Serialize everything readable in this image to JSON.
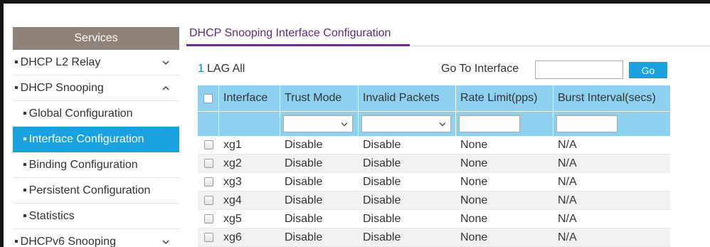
{
  "sidebar": {
    "header": "Services",
    "items": [
      {
        "label": "DHCP L2 Relay",
        "chevron": "down"
      },
      {
        "label": "DHCP Snooping",
        "chevron": "up"
      },
      {
        "label": "Global Configuration"
      },
      {
        "label": "Interface Configuration",
        "active": true
      },
      {
        "label": "Binding Configuration"
      },
      {
        "label": "Persistent Configuration"
      },
      {
        "label": "Statistics"
      },
      {
        "label": "DHCPv6 Snooping",
        "chevron": "down"
      }
    ]
  },
  "main": {
    "title": "DHCP Snooping Interface Configuration",
    "filter_one": "1",
    "filter_lag_all": "LAG All",
    "goto_label": "Go To Interface",
    "goto_value": "",
    "go_button": "Go"
  },
  "table": {
    "headers": [
      "Interface",
      "Trust Mode",
      "Invalid Packets",
      "Rate Limit(pps)",
      "Burst Interval(secs)"
    ],
    "rows": [
      {
        "interface": "xg1",
        "trust_mode": "Disable",
        "invalid_packets": "Disable",
        "rate_limit": "None",
        "burst_interval": "N/A"
      },
      {
        "interface": "xg2",
        "trust_mode": "Disable",
        "invalid_packets": "Disable",
        "rate_limit": "None",
        "burst_interval": "N/A"
      },
      {
        "interface": "xg3",
        "trust_mode": "Disable",
        "invalid_packets": "Disable",
        "rate_limit": "None",
        "burst_interval": "N/A"
      },
      {
        "interface": "xg4",
        "trust_mode": "Disable",
        "invalid_packets": "Disable",
        "rate_limit": "None",
        "burst_interval": "N/A"
      },
      {
        "interface": "xg5",
        "trust_mode": "Disable",
        "invalid_packets": "Disable",
        "rate_limit": "None",
        "burst_interval": "N/A"
      },
      {
        "interface": "xg6",
        "trust_mode": "Disable",
        "invalid_packets": "Disable",
        "rate_limit": "None",
        "burst_interval": "N/A"
      }
    ]
  },
  "colors": {
    "sidebar_header": "#8e8279",
    "active_item": "#1aa1e0",
    "table_header": "#8dd0f0",
    "title": "#5b2c83",
    "accent": "#1aa1e0"
  }
}
